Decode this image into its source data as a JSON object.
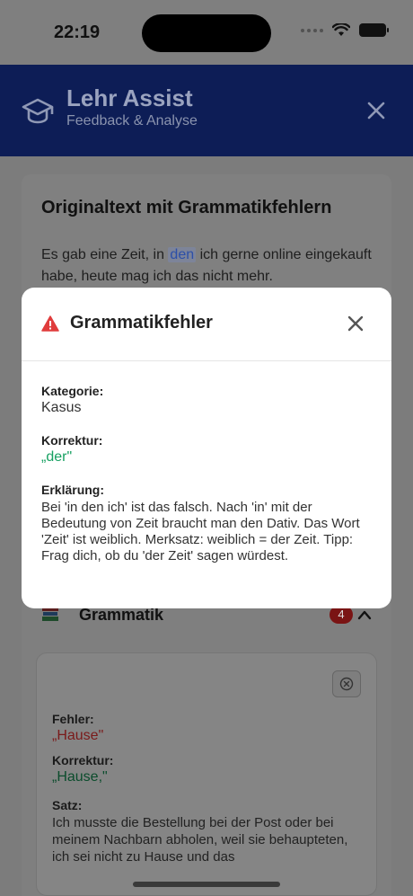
{
  "status": {
    "time": "22:19"
  },
  "header": {
    "title": "Lehr Assist",
    "subtitle": "Feedback & Analyse"
  },
  "original": {
    "title": "Originaltext mit Grammatikfehlern",
    "text_before": "Es gab eine Zeit, in ",
    "highlight": "den",
    "text_after": " ich gerne online eingekauft habe, heute mag ich das nicht mehr."
  },
  "grammar": {
    "icon": "books-icon",
    "title": "Grammatik",
    "count": "4",
    "error_card": {
      "fehler_label": "Fehler:",
      "fehler_value": "„Hause\"",
      "korrektur_label": "Korrektur:",
      "korrektur_value": "„Hause,\"",
      "satz_label": "Satz:",
      "satz_value": "Ich musste die Bestellung bei der Post oder bei meinem Nachbarn abholen, weil sie behaupteten, ich sei nicht zu Hause und das"
    }
  },
  "modal": {
    "title": "Grammatikfehler",
    "kategorie_label": "Kategorie:",
    "kategorie_value": "Kasus",
    "korrektur_label": "Korrektur:",
    "korrektur_value": "„der\"",
    "erklaerung_label": "Erklärung:",
    "erklaerung_value": "Bei 'in den ich' ist das falsch. Nach 'in' mit der Bedeutung von Zeit braucht man den Dativ. Das Wort 'Zeit' ist weiblich. Merksatz: weiblich = der Zeit. Tipp: Frag dich, ob du 'der Zeit' sagen würdest."
  },
  "colors": {
    "header_bg": "#0d1d56",
    "warning_red": "#e03c3c",
    "correction_green": "#16a061",
    "highlight_blue": "#2c4fa8"
  }
}
